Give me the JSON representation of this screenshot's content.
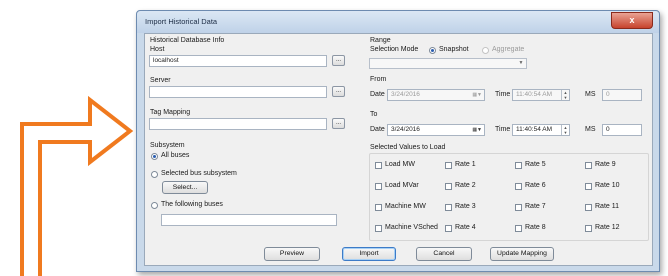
{
  "window": {
    "title": "Import Historical Data",
    "close_glyph": "x"
  },
  "left": {
    "section_title": "Historical Database Info",
    "host_label": "Host",
    "host_value": "localhost",
    "server_label": "Server",
    "server_value": "",
    "tag_mapping_label": "Tag Mapping",
    "tag_mapping_value": "",
    "browse_label": "...",
    "subsystem_title": "Subsystem",
    "subsystem_options": [
      "All buses",
      "Selected bus subsystem",
      "The following buses"
    ],
    "subsystem_selected": "All buses",
    "select_button": "Select...",
    "following_buses_value": ""
  },
  "range": {
    "title": "Range",
    "selection_mode_label": "Selection Mode",
    "modes": [
      "Snapshot",
      "Aggregate"
    ],
    "mode_selected": "Snapshot",
    "aggregate_value": "",
    "from_label": "From",
    "to_label": "To",
    "date_label": "Date",
    "time_label": "Time",
    "ms_label": "MS",
    "from_date": "3/24/2016",
    "from_time": "11:40:54 AM",
    "from_ms": "0",
    "to_date": "3/24/2016",
    "to_time": "11:40:54 AM",
    "to_ms": "0"
  },
  "values": {
    "title": "Selected Values to Load",
    "col1": [
      "Load MW",
      "Load MVar",
      "Machine MW",
      "Machine VSched"
    ],
    "col2": [
      "Rate 1",
      "Rate 2",
      "Rate 3",
      "Rate 4"
    ],
    "col3": [
      "Rate 5",
      "Rate 6",
      "Rate 7",
      "Rate 8"
    ],
    "col4": [
      "Rate 9",
      "Rate 10",
      "Rate 11",
      "Rate 12"
    ]
  },
  "buttons": {
    "preview": "Preview",
    "import": "Import",
    "cancel": "Cancel",
    "update_mapping": "Update Mapping"
  },
  "colors": {
    "arrow": "#f07a1f",
    "titlebar": "#c9d9ea",
    "close": "#c7432d",
    "dialog": "#f0f0f0"
  },
  "icons": {
    "arrow": "bent-arrow-icon",
    "calendar": "calendar-dropdown-icon",
    "spinner": "time-spinner-icon"
  }
}
